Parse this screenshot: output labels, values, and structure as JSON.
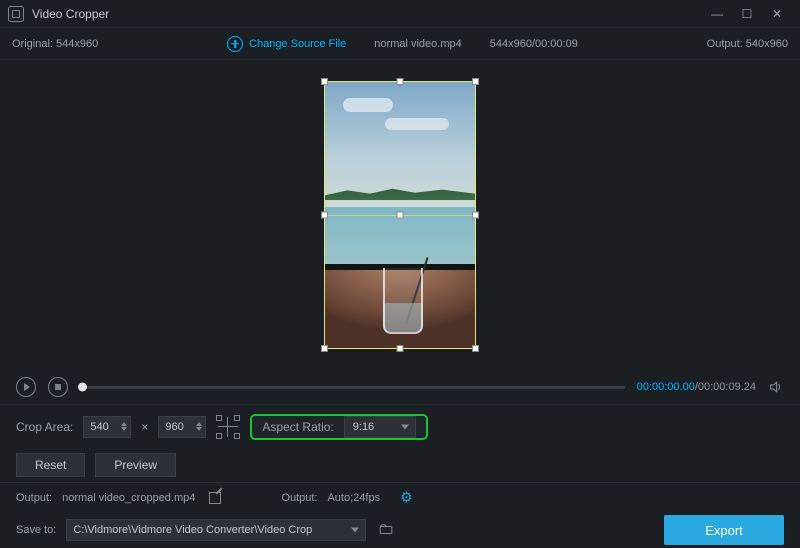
{
  "window": {
    "title": "Video Cropper"
  },
  "infobar": {
    "original_label": "Original:",
    "original_value": "544x960",
    "change_source": "Change Source File",
    "filename": "normal video.mp4",
    "src_info": "544x960/00:00:09",
    "output_label": "Output:",
    "output_value": "540x960"
  },
  "transport": {
    "current": "00:00:00.00",
    "total": "/00:00:09.24"
  },
  "crop": {
    "label": "Crop Area:",
    "width": "540",
    "height": "960",
    "aspect_label": "Aspect Ratio:",
    "aspect_value": "9:16"
  },
  "buttons": {
    "reset": "Reset",
    "preview": "Preview",
    "export": "Export"
  },
  "output": {
    "label1": "Output:",
    "filename": "normal video_cropped.mp4",
    "label2": "Output:",
    "format": "Auto;24fps"
  },
  "save": {
    "label": "Save to:",
    "path": "C:\\Vidmore\\Vidmore Video Converter\\Video Crop"
  }
}
